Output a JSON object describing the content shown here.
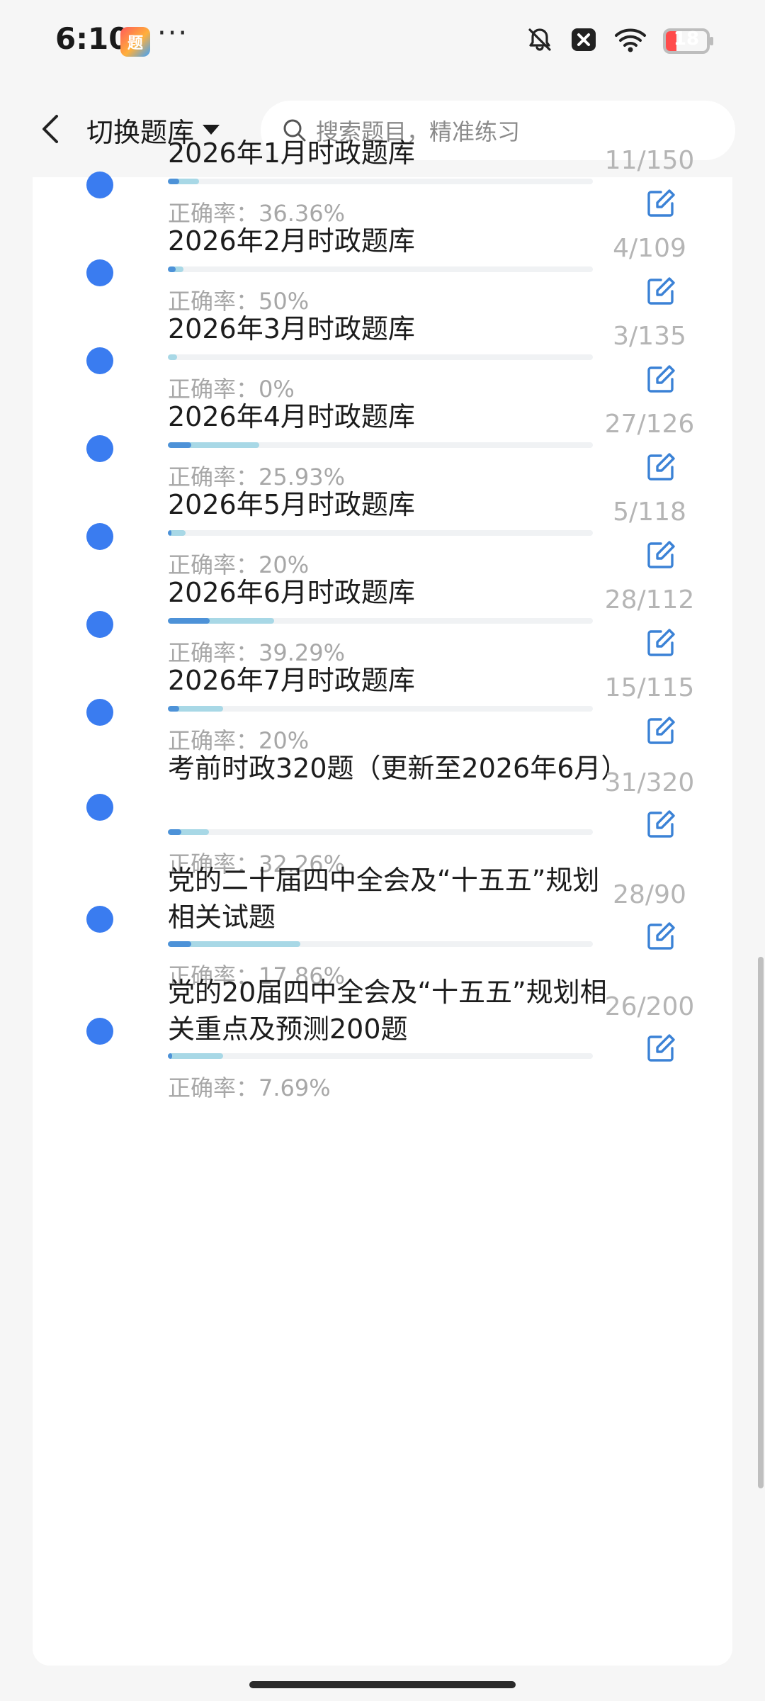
{
  "status_bar": {
    "time": "6:10",
    "app_icon_text": "题",
    "more": "···",
    "battery_level": "18"
  },
  "header": {
    "switch_label": "切换题库",
    "search_placeholder": "搜索题目，精准练习"
  },
  "colors": {
    "dot_blue": "#3a7cf0",
    "edit_blue": "#3b82d6",
    "progress_total": "#a8d8e6",
    "progress_correct": "#4d92d8",
    "battery_red": "#ff4b4b"
  },
  "banks": [
    {
      "title": "2026年1月时政题库",
      "accuracy": "正确率：36.36%",
      "count": "11/150",
      "done": 11,
      "total": 150,
      "rate": 0.3636
    },
    {
      "title": "2026年2月时政题库",
      "accuracy": "正确率：50%",
      "count": "4/109",
      "done": 4,
      "total": 109,
      "rate": 0.5
    },
    {
      "title": "2026年3月时政题库",
      "accuracy": "正确率：0%",
      "count": "3/135",
      "done": 3,
      "total": 135,
      "rate": 0
    },
    {
      "title": "2026年4月时政题库",
      "accuracy": "正确率：25.93%",
      "count": "27/126",
      "done": 27,
      "total": 126,
      "rate": 0.2593
    },
    {
      "title": "2026年5月时政题库",
      "accuracy": "正确率：20%",
      "count": "5/118",
      "done": 5,
      "total": 118,
      "rate": 0.2
    },
    {
      "title": "2026年6月时政题库",
      "accuracy": "正确率：39.29%",
      "count": "28/112",
      "done": 28,
      "total": 112,
      "rate": 0.3929
    },
    {
      "title": "2026年7月时政题库",
      "accuracy": "正确率：20%",
      "count": "15/115",
      "done": 15,
      "total": 115,
      "rate": 0.2
    },
    {
      "title": "考前时政320题（更新至2026年6月）",
      "accuracy": "正确率：32.26%",
      "count": "31/320",
      "done": 31,
      "total": 320,
      "rate": 0.3226
    },
    {
      "title": "党的二十届四中全会及“十五五”规划相关试题",
      "accuracy": "正确率：17.86%",
      "count": "28/90",
      "done": 28,
      "total": 90,
      "rate": 0.1786
    },
    {
      "title": "党的20届四中全会及“十五五”规划相关重点及预测200题",
      "accuracy": "正确率：7.69%",
      "count": "26/200",
      "done": 26,
      "total": 200,
      "rate": 0.0769
    }
  ]
}
